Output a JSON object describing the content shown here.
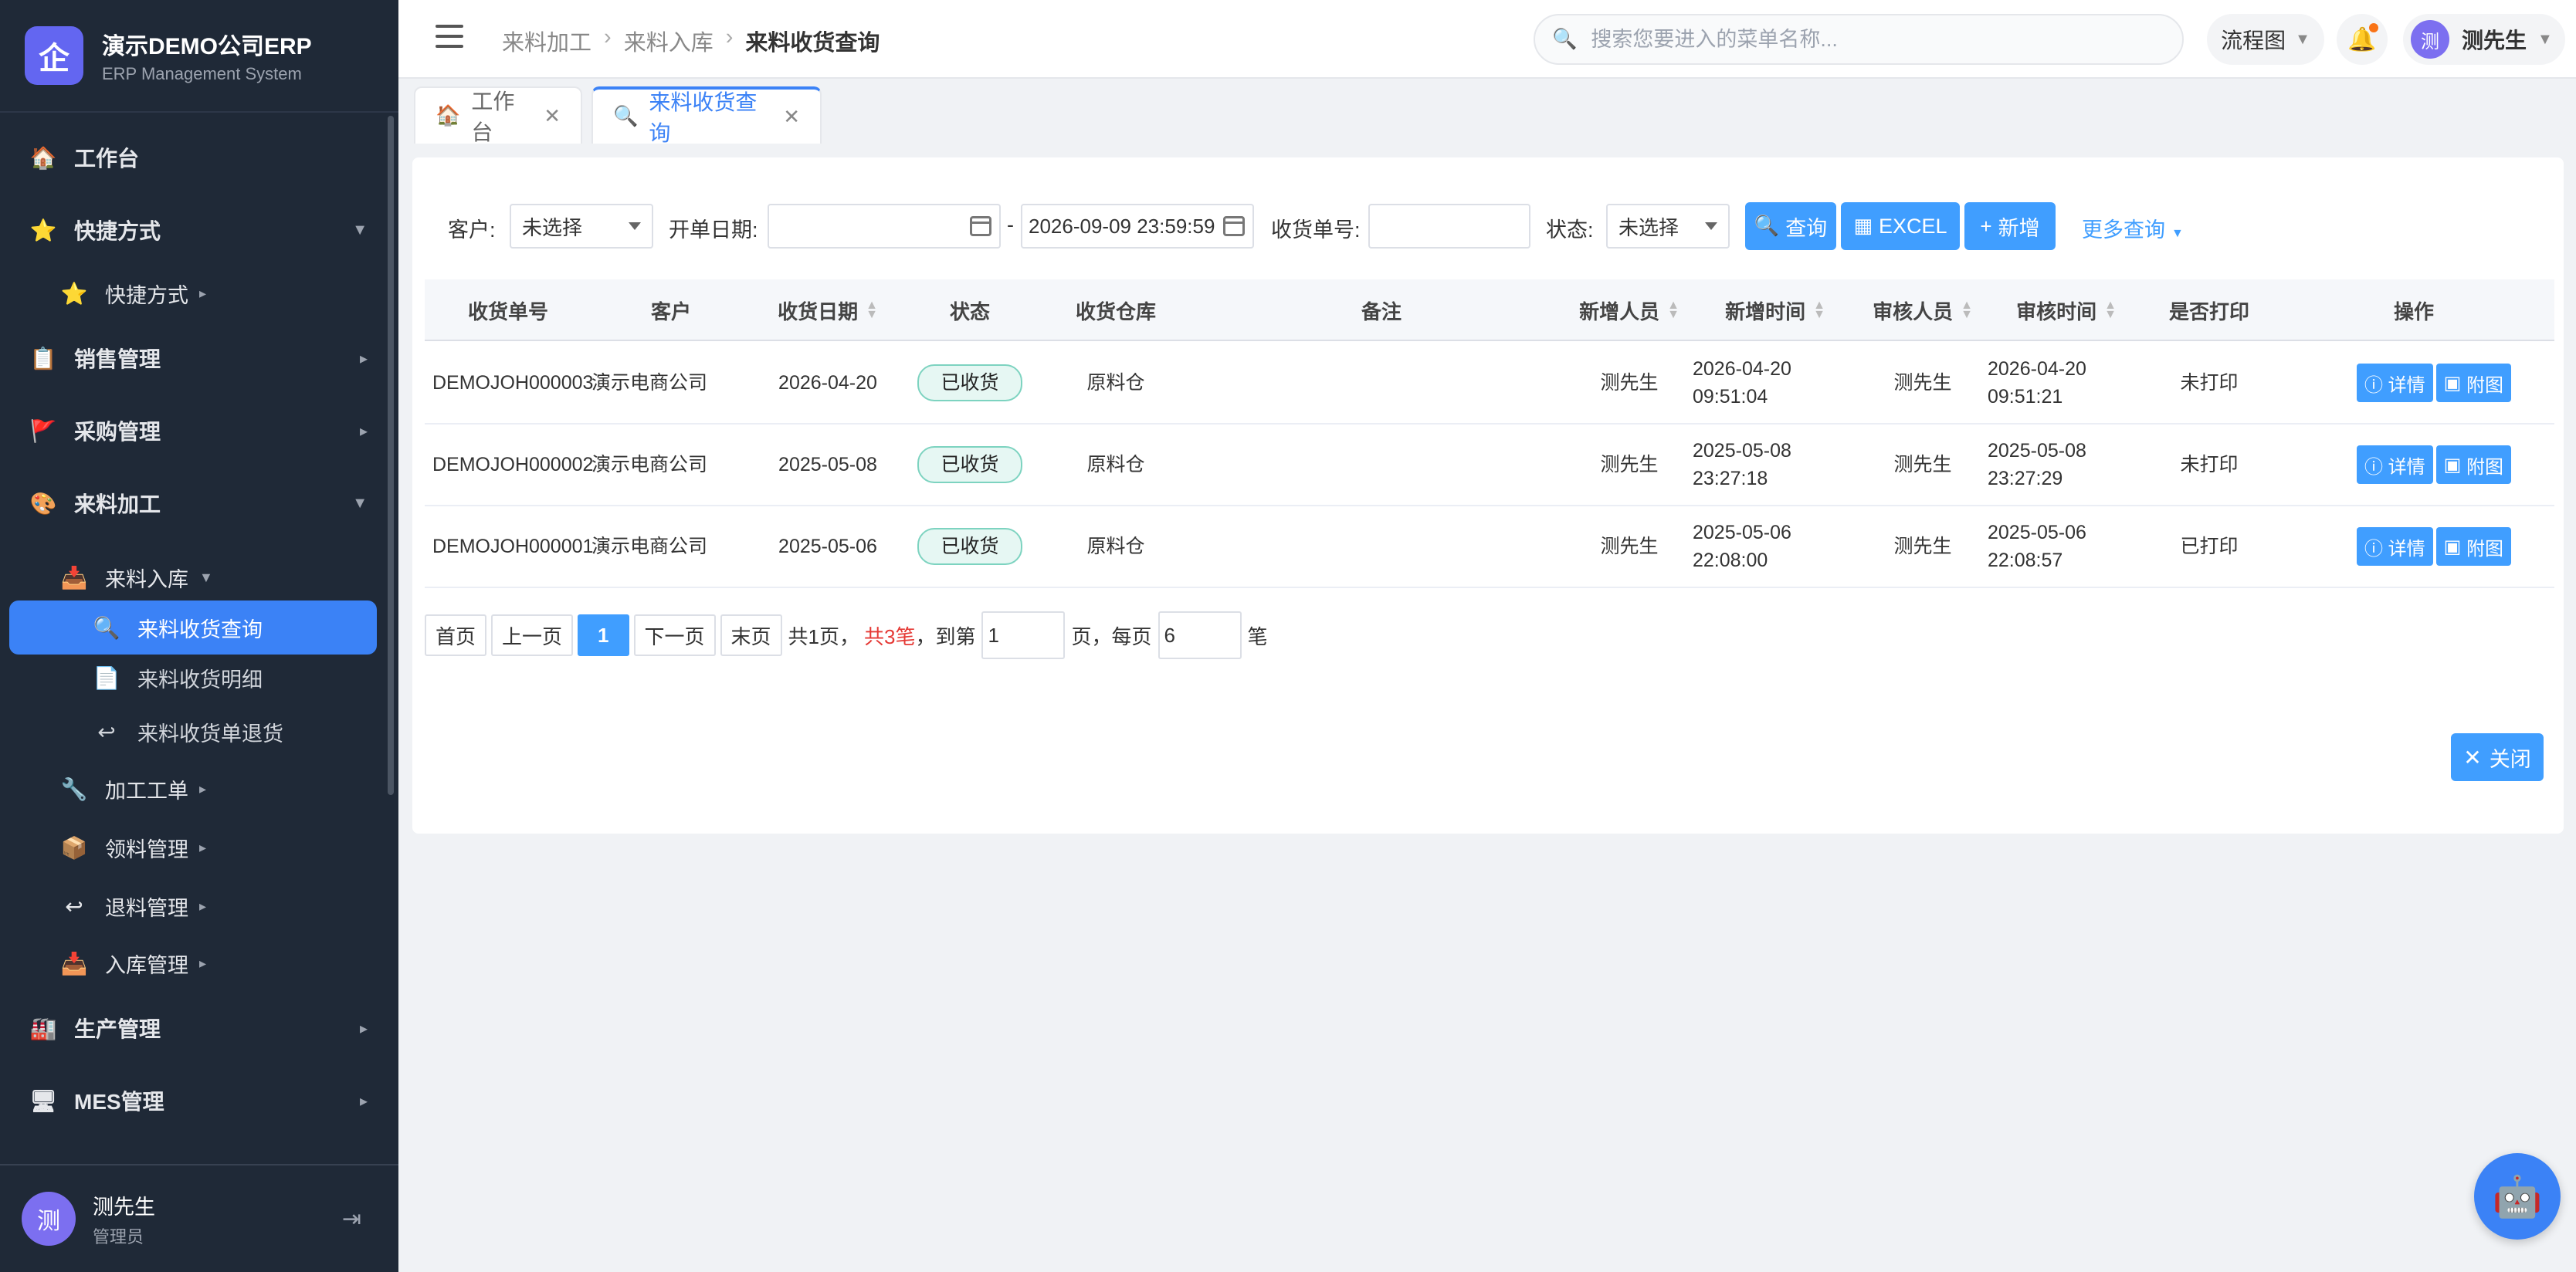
{
  "brand": {
    "logo": "企",
    "title": "演示DEMO公司ERP",
    "subtitle": "ERP Management System"
  },
  "sidebar": {
    "items": [
      {
        "label": "工作台",
        "icon": "🏠",
        "icon_name": "home-icon",
        "level": 1
      },
      {
        "label": "快捷方式",
        "icon": "⭐",
        "icon_name": "star-icon",
        "level": 1,
        "arrow": "▼"
      },
      {
        "label": "快捷方式",
        "icon": "⭐",
        "icon_name": "star-icon",
        "level": 2,
        "arrow": "▸"
      },
      {
        "label": "销售管理",
        "icon": "📋",
        "icon_name": "clipboard-icon",
        "level": 1,
        "arrow": "▸"
      },
      {
        "label": "采购管理",
        "icon": "🚩",
        "icon_name": "flag-icon",
        "level": 1,
        "arrow": "▸"
      },
      {
        "label": "来料加工",
        "icon": "🎨",
        "icon_name": "palette-icon",
        "level": 1,
        "arrow": "▼"
      },
      {
        "label": "来料入库",
        "icon": "📥",
        "icon_name": "inbox-icon",
        "level": 2,
        "arrow": "▼"
      },
      {
        "label": "来料收货查询",
        "icon": "🔍",
        "icon_name": "search-icon",
        "level": 3,
        "active": true
      },
      {
        "label": "来料收货明细",
        "icon": "📄",
        "icon_name": "document-icon",
        "level": 3
      },
      {
        "label": "来料收货单退货",
        "icon": "↩",
        "icon_name": "return-icon",
        "level": 3
      },
      {
        "label": "加工工单",
        "icon": "🔧",
        "icon_name": "wrench-icon",
        "level": 2,
        "arrow": "▸"
      },
      {
        "label": "领料管理",
        "icon": "📦",
        "icon_name": "package-icon",
        "level": 2,
        "arrow": "▸"
      },
      {
        "label": "退料管理",
        "icon": "↩",
        "icon_name": "return-icon",
        "level": 2,
        "arrow": "▸"
      },
      {
        "label": "入库管理",
        "icon": "📥",
        "icon_name": "inbox-icon",
        "level": 2,
        "arrow": "▸"
      },
      {
        "label": "生产管理",
        "icon": "🏭",
        "icon_name": "factory-icon",
        "level": 1,
        "arrow": "▸"
      },
      {
        "label": "MES管理",
        "icon": "🖥",
        "icon_name": "monitor-icon",
        "level": 1,
        "arrow": "▸"
      }
    ]
  },
  "user": {
    "avatar": "测",
    "name": "测先生",
    "role": "管理员"
  },
  "header": {
    "breadcrumb": [
      "来料加工",
      "来料入库",
      "来料收货查询"
    ],
    "search_placeholder": "搜索您要进入的菜单名称...",
    "flow_label": "流程图",
    "user_avatar": "测",
    "user_name": "测先生"
  },
  "tabs": [
    {
      "label": "工作台",
      "icon": "🏠"
    },
    {
      "label": "来料收货查询",
      "icon": "🔍",
      "active": true
    }
  ],
  "filter": {
    "customer_label": "客户:",
    "customer_value": "未选择",
    "date_label": "开单日期:",
    "date_start": "",
    "date_sep": "-",
    "date_end": "2026-09-09 23:59:59",
    "order_no_label": "收货单号:",
    "order_no_value": "",
    "status_label": "状态:",
    "status_value": "未选择",
    "query_btn": "查询",
    "excel_btn": "EXCEL",
    "add_btn": "新增",
    "more_query": "更多查询"
  },
  "table": {
    "columns": [
      "收货单号",
      "客户",
      "收货日期",
      "状态",
      "收货仓库",
      "备注",
      "新增人员",
      "新增时间",
      "审核人员",
      "审核时间",
      "是否打印",
      "操作"
    ],
    "rows": [
      {
        "order_no": "DEMOJOH000003",
        "customer": "演示电商公司",
        "date": "2026-04-20",
        "status": "已收货",
        "warehouse": "原料仓",
        "remark": "",
        "creator": "测先生",
        "create_date": "2026-04-20",
        "create_time": "09:51:04",
        "auditor": "测先生",
        "audit_date": "2026-04-20",
        "audit_time": "09:51:21",
        "printed": "未打印"
      },
      {
        "order_no": "DEMOJOH000002",
        "customer": "演示电商公司",
        "date": "2025-05-08",
        "status": "已收货",
        "warehouse": "原料仓",
        "remark": "",
        "creator": "测先生",
        "create_date": "2025-05-08",
        "create_time": "23:27:18",
        "auditor": "测先生",
        "audit_date": "2025-05-08",
        "audit_time": "23:27:29",
        "printed": "未打印"
      },
      {
        "order_no": "DEMOJOH000001",
        "customer": "演示电商公司",
        "date": "2025-05-06",
        "status": "已收货",
        "warehouse": "原料仓",
        "remark": "",
        "creator": "测先生",
        "create_date": "2025-05-06",
        "create_time": "22:08:00",
        "auditor": "测先生",
        "audit_date": "2025-05-06",
        "audit_time": "22:08:57",
        "printed": "已打印"
      }
    ],
    "detail_btn": "详情",
    "attach_btn": "附图"
  },
  "pager": {
    "first": "首页",
    "prev": "上一页",
    "current": "1",
    "next": "下一页",
    "last": "末页",
    "total_pages": "共1页，",
    "total_records": "共3笔",
    "goto_prefix": "，到第",
    "goto_value": "1",
    "page_suffix": "页，每页",
    "per_page": "6",
    "unit": "笔"
  },
  "close_btn": "关闭",
  "colors": {
    "primary": "#409eff",
    "sidebar_bg": "#1f2937",
    "active_menu": "#3b82f6",
    "badge_border": "#7dd3c0"
  }
}
